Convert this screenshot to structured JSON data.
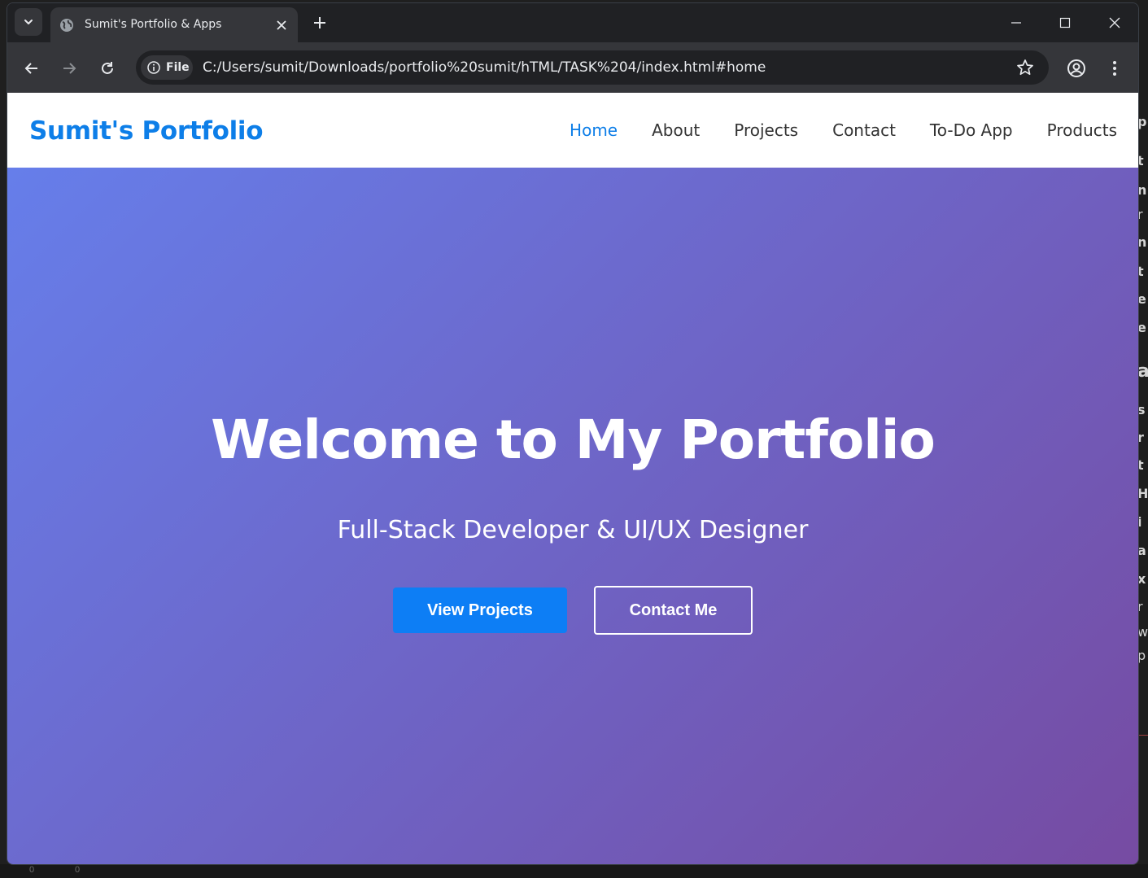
{
  "browser": {
    "tab_title": "Sumit's Portfolio & Apps",
    "site_chip_label": "File",
    "url": "C:/Users/sumit/Downloads/portfolio%20sumit/hTML/TASK%204/index.html#home"
  },
  "site": {
    "brand": "Sumit's Portfolio",
    "nav": [
      {
        "label": "Home",
        "active": true
      },
      {
        "label": "About"
      },
      {
        "label": "Projects"
      },
      {
        "label": "Contact"
      },
      {
        "label": "To-Do App"
      },
      {
        "label": "Products"
      }
    ]
  },
  "hero": {
    "title": "Welcome to My Portfolio",
    "subtitle": "Full-Stack Developer & UI/UX Designer",
    "primary_button": "View Projects",
    "secondary_button": "Contact Me"
  },
  "background_status": [
    "0",
    "0"
  ],
  "colors": {
    "accent": "#0d7ee8",
    "gradient_start": "#667eea",
    "gradient_end": "#764ba2",
    "browser_frame": "#202124",
    "browser_toolbar": "#35363a"
  }
}
